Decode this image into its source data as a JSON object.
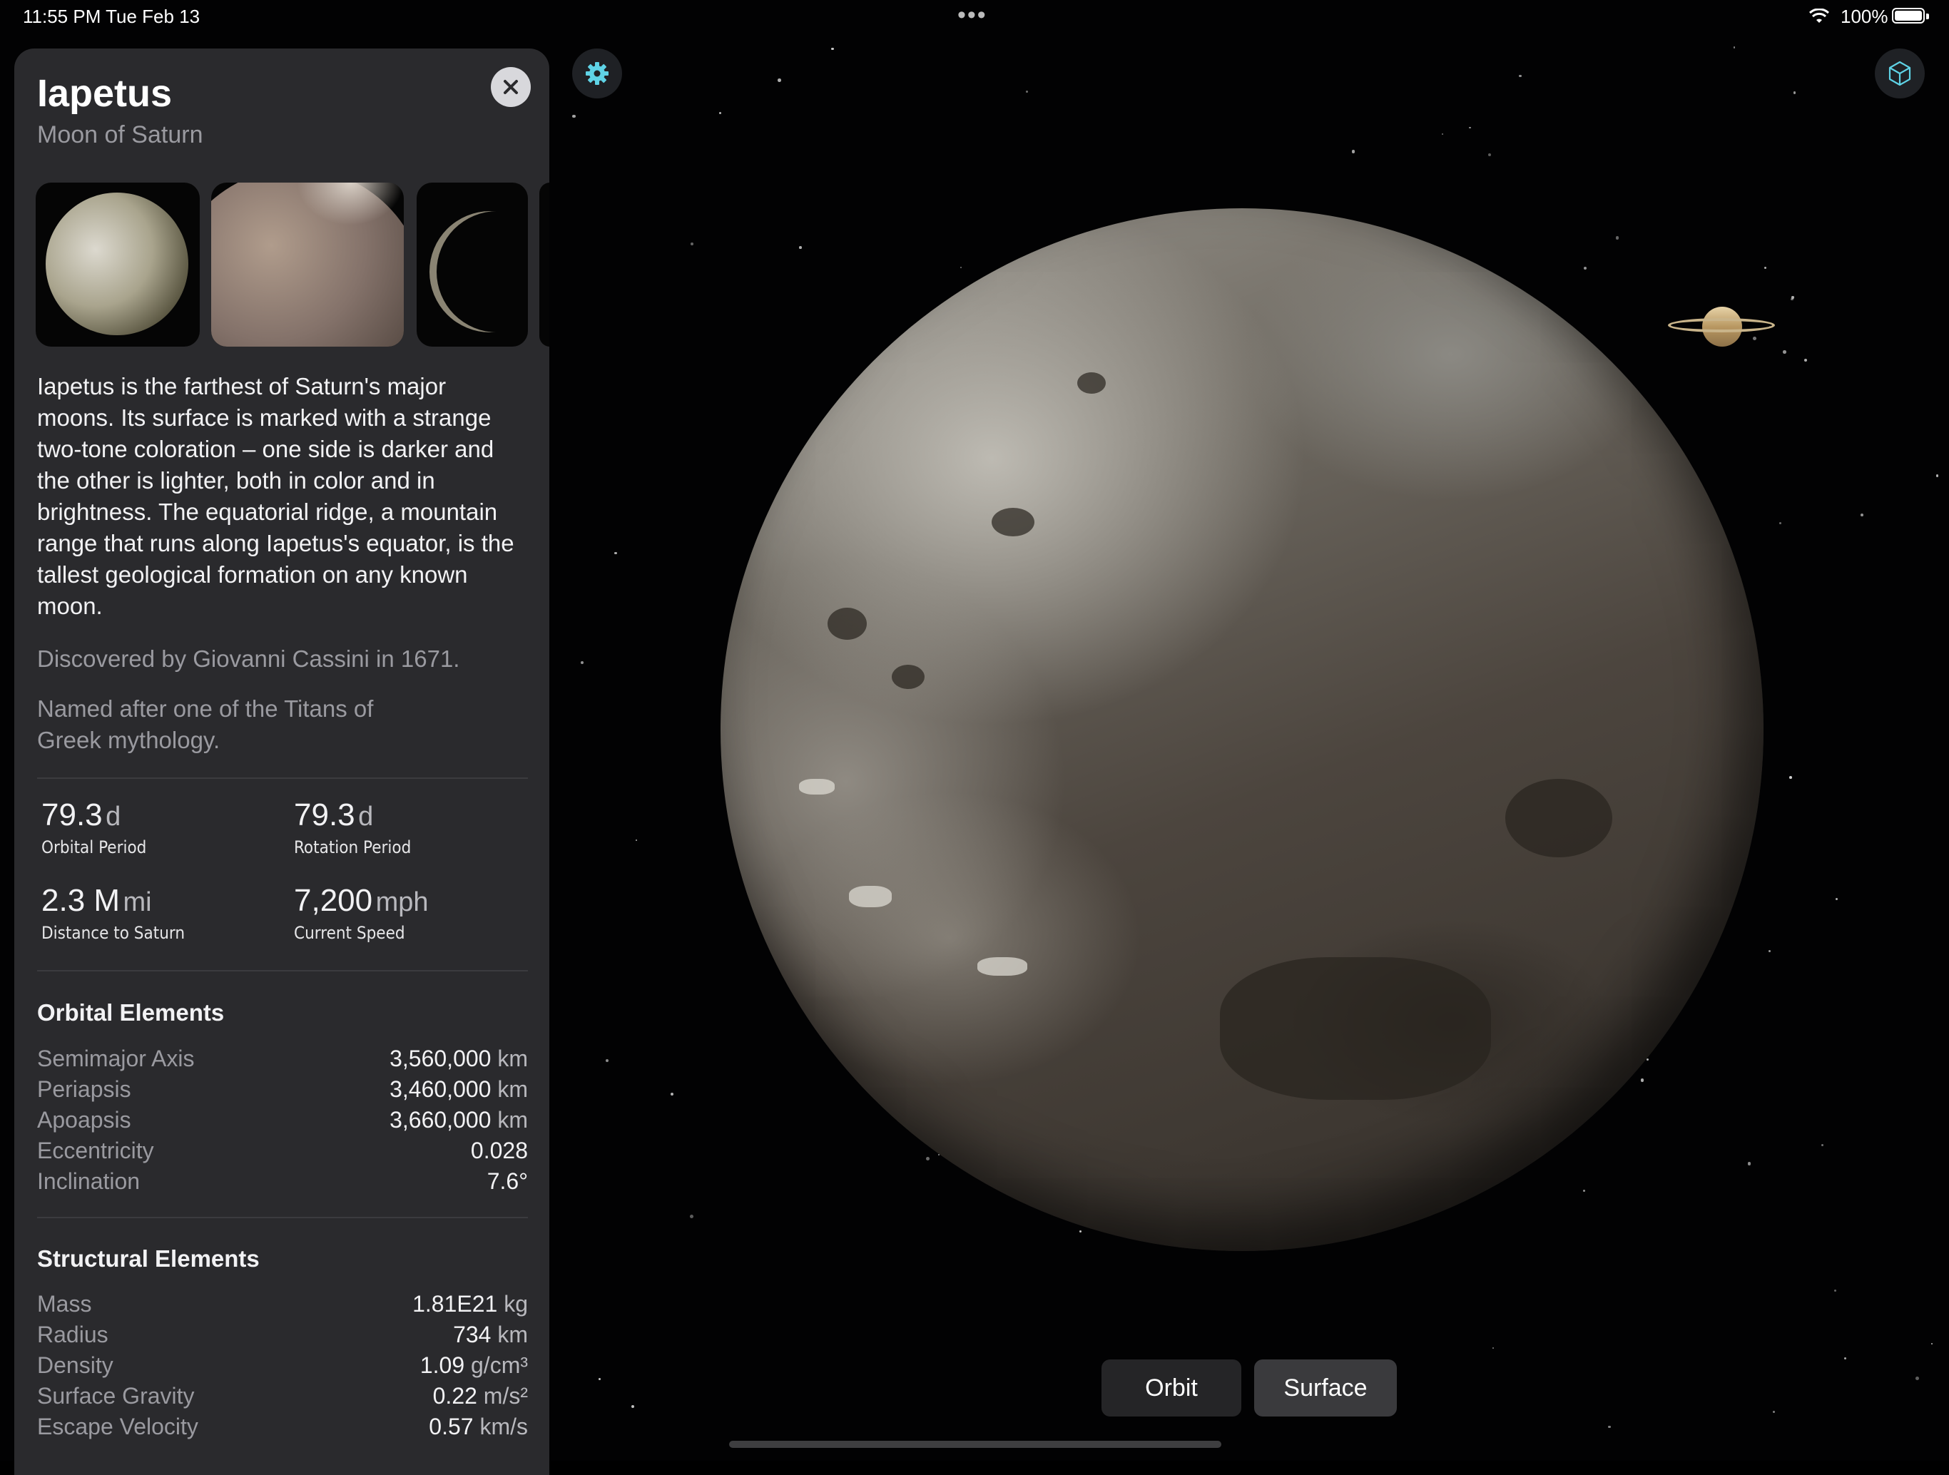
{
  "status_bar": {
    "time": "11:55 PM   Tue Feb 13",
    "dots": "•••",
    "battery": "100%"
  },
  "panel": {
    "title": "Iapetus",
    "subtitle": "Moon of Saturn",
    "description": "Iapetus is the farthest of Saturn's major moons. Its surface is marked with a strange two-tone coloration – one side is darker and the other is lighter, both in color and in brightness. The equatorial ridge, a mountain range that runs along Iapetus's equator, is the tallest geological formation on any known moon.",
    "discovered": "Discovered by Giovanni Cassini in 1671.",
    "named": "Named after one of the Titans of Greek mythology.",
    "stats": [
      {
        "value": "79.3",
        "unit": "d",
        "label": "Orbital Period"
      },
      {
        "value": "79.3",
        "unit": "d",
        "label": "Rotation Period"
      },
      {
        "value": "2.3 M",
        "unit": "mi",
        "label": "Distance to Saturn"
      },
      {
        "value": "7,200",
        "unit": "mph",
        "label": "Current Speed"
      }
    ],
    "orbital_title": "Orbital Elements",
    "orbital": [
      {
        "key": "Semimajor Axis",
        "value": "3,560,000",
        "unit": "km"
      },
      {
        "key": "Periapsis",
        "value": "3,460,000",
        "unit": "km"
      },
      {
        "key": "Apoapsis",
        "value": "3,660,000",
        "unit": "km"
      },
      {
        "key": "Eccentricity",
        "value": "0.028",
        "unit": ""
      },
      {
        "key": "Inclination",
        "value": "7.6°",
        "unit": ""
      }
    ],
    "structural_title": "Structural Elements",
    "structural": [
      {
        "key": "Mass",
        "value": "1.81E21",
        "unit": "kg"
      },
      {
        "key": "Radius",
        "value": "734",
        "unit": "km"
      },
      {
        "key": "Density",
        "value": "1.09",
        "unit": "g/cm³"
      },
      {
        "key": "Surface Gravity",
        "value": "0.22",
        "unit": "m/s²"
      },
      {
        "key": "Escape Velocity",
        "value": "0.57",
        "unit": "km/s"
      }
    ]
  },
  "bottom": {
    "orbit_label": "Orbit",
    "surface_label": "Surface"
  },
  "colors": {
    "accent": "#5fd3e6",
    "panel_bg": "#2a2a2d"
  }
}
